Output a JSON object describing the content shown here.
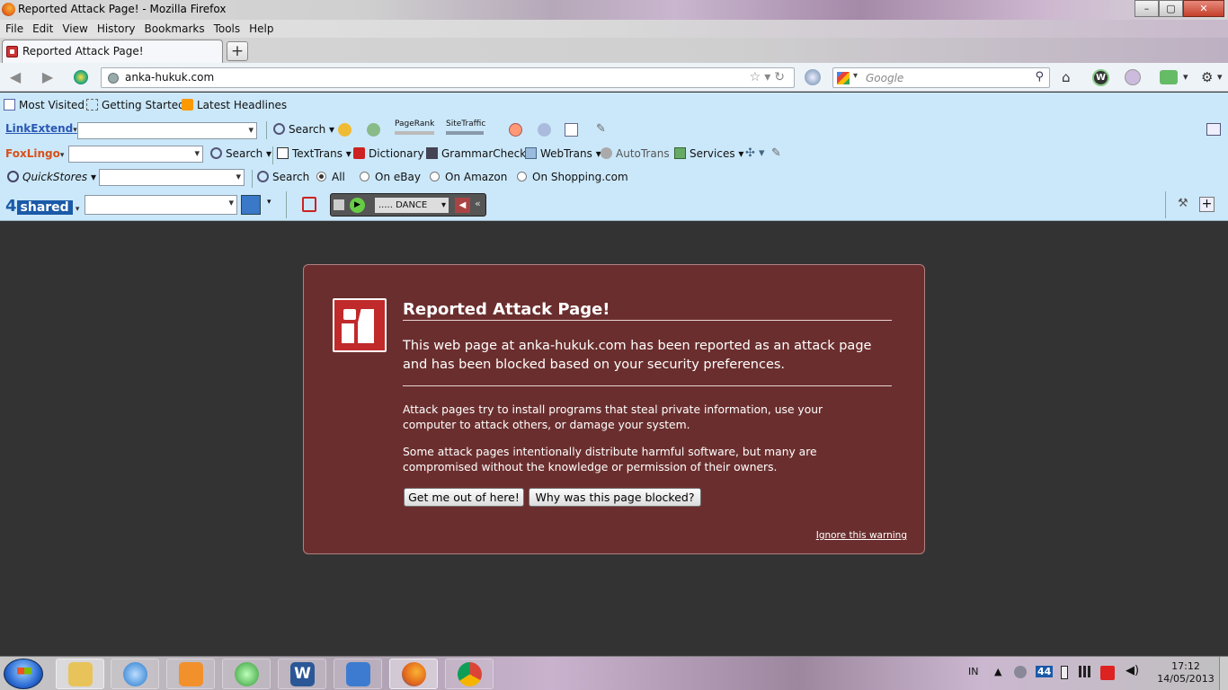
{
  "window": {
    "title": "Reported Attack Page! - Mozilla Firefox",
    "controls": [
      "–",
      "▢",
      "✕"
    ]
  },
  "menu": [
    "File",
    "Edit",
    "View",
    "History",
    "Bookmarks",
    "Tools",
    "Help"
  ],
  "tabs": [
    {
      "label": "Reported Attack Page!"
    }
  ],
  "newtab_label": "+",
  "nav": {
    "url": "anka-hukuk.com",
    "search_placeholder": "Google"
  },
  "bookmarks": [
    "Most Visited",
    "Getting Started",
    "Latest Headlines"
  ],
  "linkextend": {
    "logo": "LinkExtend",
    "search": "Search",
    "pagerank": "PageRank",
    "sitetraffic": "SiteTraffic"
  },
  "foxlingo": {
    "logo": "FoxLingo",
    "search": "Search",
    "texttrans": "TextTrans",
    "dictionary": "Dictionary",
    "grammar": "GrammarCheck",
    "webtrans": "WebTrans",
    "autotrans": "AutoTrans",
    "services": "Services"
  },
  "quickstores": {
    "logo": "QuickStores",
    "search": "Search",
    "options": [
      "All",
      "On eBay",
      "On Amazon",
      "On Shopping.com"
    ],
    "selected": "All"
  },
  "shared4": {
    "logo_num": "4",
    "logo_text": "shared",
    "radio": "..... DANCE"
  },
  "error": {
    "title": "Reported Attack Page!",
    "p1": "This web page at anka-hukuk.com has been reported as an attack page and has been blocked based on your security preferences.",
    "p2": "Attack pages try to install programs that steal private information, use your computer to attack others, or damage your system.",
    "p3": "Some attack pages intentionally distribute harmful software, but many are compromised without the knowledge or permission of their owners.",
    "btn_escape": "Get me out of here!",
    "btn_why": "Why was this page blocked?",
    "ignore": "Ignore this warning"
  },
  "taskbar": {
    "lang": "IN",
    "badge": "44",
    "time": "17:12",
    "date": "14/05/2013"
  },
  "colors": {
    "error_bg": "#6b2e2e",
    "toolbar_bg": "#cbe8fa",
    "content_bg": "#333333"
  }
}
